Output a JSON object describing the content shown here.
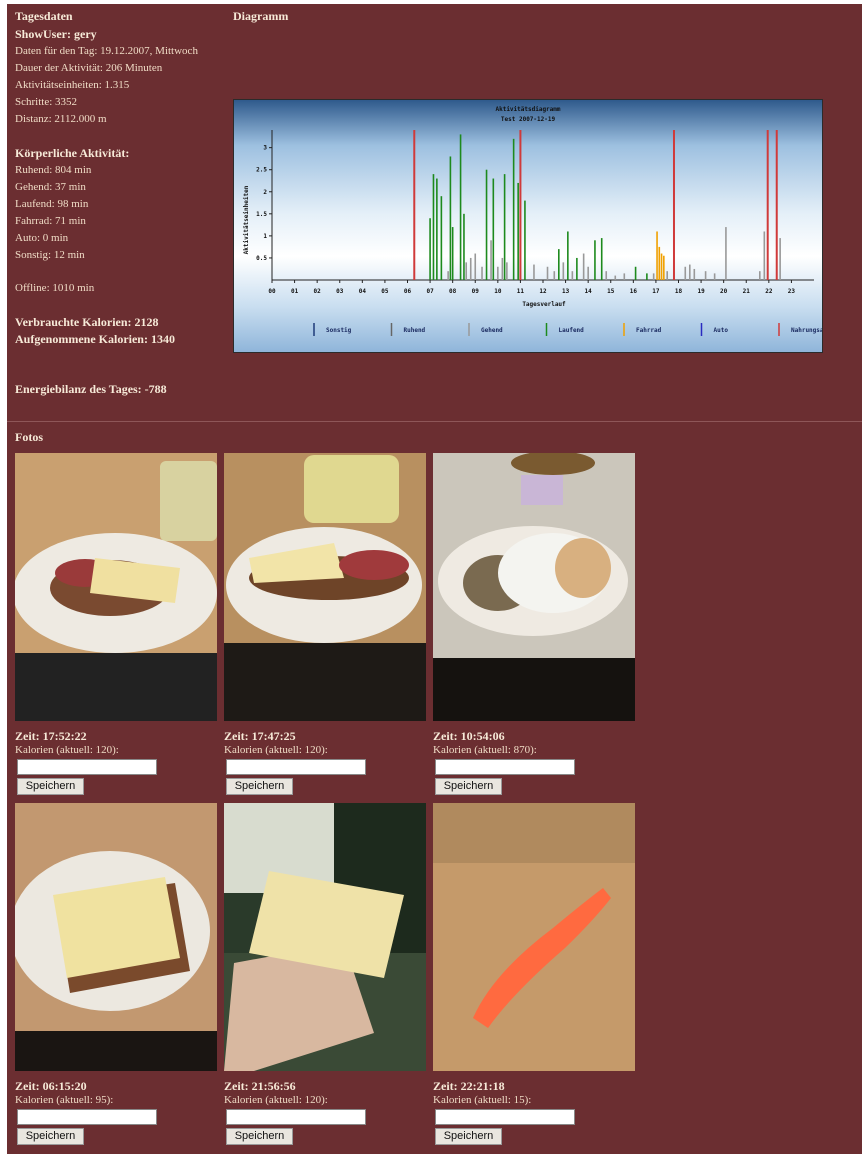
{
  "headings": {
    "tagesdaten": "Tagesdaten",
    "diagramm": "Diagramm",
    "fotos": "Fotos"
  },
  "user": {
    "show_user": "ShowUser: gery"
  },
  "daily": {
    "date": "Daten für den Tag: 19.12.2007, Mittwoch",
    "duration": "Dauer der Aktivität: 206 Minuten",
    "units": "Aktivitätseinheiten: 1.315",
    "steps": "Schritte: 3352",
    "distance": "Distanz: 2112.000 m"
  },
  "activity": {
    "title": "Körperliche Aktivität:",
    "ruhend": "Ruhend: 804 min",
    "gehend": "Gehend: 37 min",
    "laufend": "Laufend: 98 min",
    "fahrrad": "Fahrrad: 71 min",
    "auto": "Auto: 0 min",
    "sonstig": "Sonstig: 12 min",
    "offline": "Offline: 1010 min"
  },
  "calories": {
    "burned": "Verbrauchte Kalorien: 2128",
    "taken": "Aufgenommene Kalorien: 1340",
    "balance": "Energiebilanz des Tages: -788"
  },
  "chart_data": {
    "type": "bar",
    "title": "Aktivitätsdiagramm",
    "subtitle": "Test 2007-12-19",
    "xlabel": "Tagesverlauf",
    "ylabel": "Aktivitätseinheiten",
    "xlim": [
      0,
      24
    ],
    "ylim": [
      0,
      3.4
    ],
    "x_ticks": [
      "00",
      "01",
      "02",
      "03",
      "04",
      "05",
      "06",
      "07",
      "08",
      "09",
      "10",
      "11",
      "12",
      "13",
      "14",
      "15",
      "16",
      "17",
      "18",
      "19",
      "20",
      "21",
      "22",
      "23"
    ],
    "y_ticks": [
      "0.5",
      "1",
      "1.5",
      "2",
      "2.5",
      "3"
    ],
    "legend": [
      {
        "name": "Sonstig",
        "color": "#1e3a78"
      },
      {
        "name": "Ruhend",
        "color": "#666666"
      },
      {
        "name": "Gehend",
        "color": "#999999"
      },
      {
        "name": "Laufend",
        "color": "#1d8a1d"
      },
      {
        "name": "Fahrrad",
        "color": "#f0a000"
      },
      {
        "name": "Auto",
        "color": "#2a2ac0"
      },
      {
        "name": "Nahrungsaufnahme",
        "color": "#d03a3a"
      }
    ],
    "colors": {
      "Laufend": "#1d8a1d",
      "Gehend": "#999999",
      "Fahrrad": "#f0a000",
      "Nahrungsaufnahme": "#d03a3a"
    },
    "series": [
      {
        "name": "Nahrungsaufnahme",
        "points": [
          [
            6.3,
            3.4
          ],
          [
            11.0,
            3.4
          ],
          [
            17.8,
            3.4
          ],
          [
            21.95,
            3.4
          ],
          [
            22.35,
            3.4
          ]
        ]
      },
      {
        "name": "Laufend",
        "points": [
          [
            7.0,
            1.4
          ],
          [
            7.15,
            2.4
          ],
          [
            7.3,
            2.3
          ],
          [
            7.5,
            1.9
          ],
          [
            7.9,
            2.8
          ],
          [
            8.0,
            1.2
          ],
          [
            8.35,
            3.3
          ],
          [
            8.5,
            1.5
          ],
          [
            9.5,
            2.5
          ],
          [
            9.8,
            2.3
          ],
          [
            10.3,
            2.4
          ],
          [
            10.7,
            3.2
          ],
          [
            10.9,
            2.2
          ],
          [
            11.2,
            1.8
          ],
          [
            12.7,
            0.7
          ],
          [
            13.1,
            1.1
          ],
          [
            13.5,
            0.5
          ],
          [
            14.3,
            0.9
          ],
          [
            14.6,
            0.95
          ],
          [
            16.1,
            0.3
          ],
          [
            16.6,
            0.15
          ]
        ]
      },
      {
        "name": "Gehend",
        "points": [
          [
            7.8,
            0.2
          ],
          [
            8.6,
            0.4
          ],
          [
            8.8,
            0.5
          ],
          [
            9.0,
            0.6
          ],
          [
            9.3,
            0.3
          ],
          [
            9.7,
            0.9
          ],
          [
            10.0,
            0.3
          ],
          [
            10.2,
            0.5
          ],
          [
            10.4,
            0.4
          ],
          [
            11.6,
            0.35
          ],
          [
            12.2,
            0.3
          ],
          [
            12.5,
            0.2
          ],
          [
            12.9,
            0.4
          ],
          [
            13.3,
            0.2
          ],
          [
            13.8,
            0.6
          ],
          [
            14.0,
            0.3
          ],
          [
            14.8,
            0.2
          ],
          [
            15.2,
            0.1
          ],
          [
            15.6,
            0.15
          ],
          [
            16.9,
            0.15
          ],
          [
            17.5,
            0.2
          ],
          [
            18.3,
            0.3
          ],
          [
            18.5,
            0.35
          ],
          [
            18.7,
            0.25
          ],
          [
            19.2,
            0.2
          ],
          [
            19.6,
            0.15
          ],
          [
            20.1,
            1.2
          ],
          [
            21.6,
            0.2
          ],
          [
            21.8,
            1.1
          ],
          [
            22.5,
            0.95
          ]
        ]
      },
      {
        "name": "Fahrrad",
        "points": [
          [
            17.05,
            1.1
          ],
          [
            17.15,
            0.75
          ],
          [
            17.25,
            0.6
          ],
          [
            17.35,
            0.55
          ]
        ]
      }
    ]
  },
  "photos": [
    {
      "zeit": "Zeit: 17:52:22",
      "kal": "Kalorien (aktuell: 120):",
      "btn": "Speichern",
      "input_value": ""
    },
    {
      "zeit": "Zeit: 17:47:25",
      "kal": "Kalorien (aktuell: 120):",
      "btn": "Speichern",
      "input_value": ""
    },
    {
      "zeit": "Zeit: 10:54:06",
      "kal": "Kalorien (aktuell: 870):",
      "btn": "Speichern",
      "input_value": ""
    },
    {
      "zeit": "Zeit: 06:15:20",
      "kal": "Kalorien (aktuell: 95):",
      "btn": "Speichern",
      "input_value": ""
    },
    {
      "zeit": "Zeit: 21:56:56",
      "kal": "Kalorien (aktuell: 120):",
      "btn": "Speichern",
      "input_value": ""
    },
    {
      "zeit": "Zeit: 22:21:18",
      "kal": "Kalorien (aktuell: 15):",
      "btn": "Speichern",
      "input_value": ""
    }
  ]
}
